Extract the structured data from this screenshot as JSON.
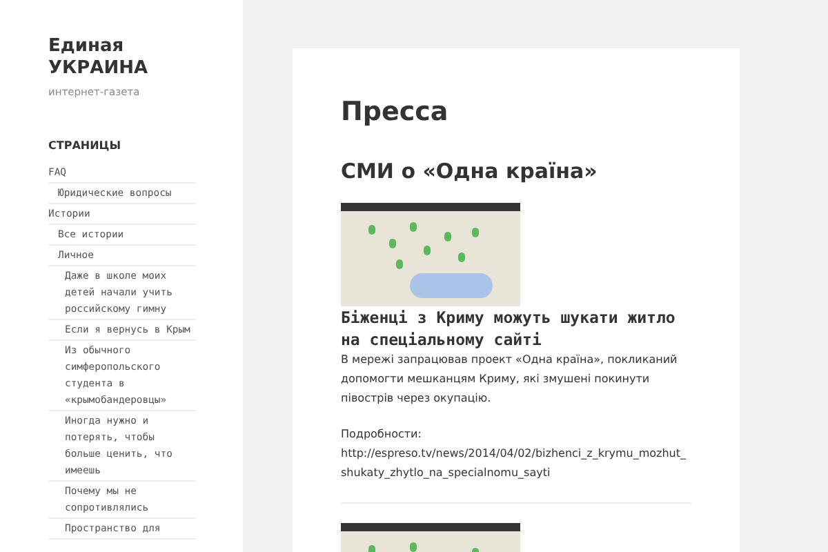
{
  "site": {
    "title": "Единая УКРАИНА",
    "tagline": "интернет-газета"
  },
  "sidebar": {
    "heading": "СТРАНИЦЫ",
    "items": [
      {
        "label": "FAQ",
        "children": [
          {
            "label": "Юридические вопросы"
          }
        ]
      },
      {
        "label": "Истории",
        "children": [
          {
            "label": "Все истории"
          },
          {
            "label": "Личное",
            "children": [
              {
                "label": "Даже в школе моих детей начали учить российскому гимну"
              },
              {
                "label": "Если я вернусь в Крым"
              },
              {
                "label": "Из обычного симферопольского студента в «крымобандеровцы»"
              },
              {
                "label": "Иногда нужно и потерять, чтобы больше ценить, что имеешь"
              },
              {
                "label": "Почему мы не сопротивлялись"
              },
              {
                "label": "Пространство для"
              }
            ]
          }
        ]
      }
    ]
  },
  "page": {
    "title": "Пресса",
    "section": "СМИ о «Одна країна»",
    "posts": [
      {
        "kind": "article",
        "title": "Біженці з Криму можуть шукати житло на спеціальному сайті",
        "text": "В мережі запрацював проект «Одна країна», покликаний допомогти мешканцям Криму, які змушені покинути півострів через окупацію.",
        "more_label": "Подробности:",
        "link": "http://espreso.tv/news/2014/04/02/bizhenci_z_krymu_mozhut_shukaty_zhytlo_na_specialnomu_sayti"
      },
      {
        "kind": "image"
      }
    ]
  }
}
